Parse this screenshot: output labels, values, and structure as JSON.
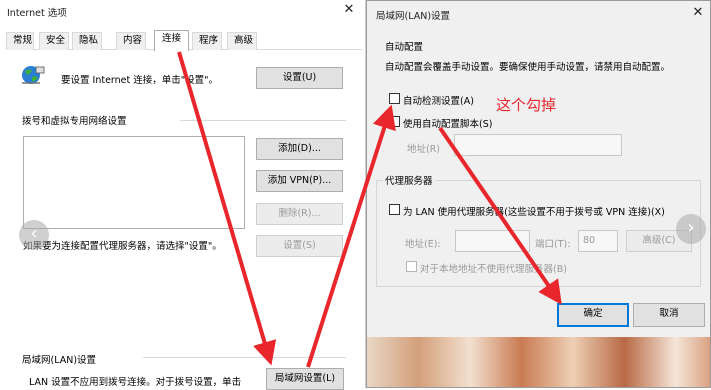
{
  "ie": {
    "title": "Internet 选项",
    "tabs": [
      "常规",
      "安全",
      "隐私",
      "内容",
      "连接",
      "程序",
      "高级"
    ],
    "active_tab": 4,
    "setup_text": "要设置 Internet 连接，单击\"设置\"。",
    "setup_button": "设置(U)",
    "dialup_section": "拨号和虚拟专用网络设置",
    "add_button": "添加(D)...",
    "add_vpn_button": "添加 VPN(P)...",
    "remove_button": "删除(R)...",
    "settings_button": "设置(S)",
    "proxy_hint": "如果要为连接配置代理服务器，请选择\"设置\"。",
    "lan_section": "局域网(LAN)设置",
    "lan_text": "LAN 设置不应用到拨号连接。对于拨号设置，单击",
    "lan_button": "局域网设置(L)"
  },
  "lan": {
    "title": "局域网(LAN)设置",
    "auto_config": {
      "group_title": "自动配置",
      "description": "自动配置会覆盖手动设置。要确保使用手动设置，请禁用自动配置。",
      "auto_detect_label": "自动检测设置(A)",
      "auto_detect_checked": false,
      "use_script_label": "使用自动配置脚本(S)",
      "use_script_checked": false,
      "address_label": "地址(R)",
      "address_value": ""
    },
    "proxy": {
      "group_title": "代理服务器",
      "use_proxy_label": "为 LAN 使用代理服务器(这些设置不用于拨号或 VPN 连接)(X)",
      "use_proxy_checked": false,
      "address_label": "地址(E):",
      "address_value": "",
      "port_label": "端口(T):",
      "port_value": "80",
      "advanced_button": "高级(C)",
      "bypass_label": "对于本地地址不使用代理服务器(B)"
    },
    "ok_button": "确定",
    "cancel_button": "取消"
  },
  "annotation": {
    "text": "这个勾掉",
    "color": "#e8262b"
  }
}
